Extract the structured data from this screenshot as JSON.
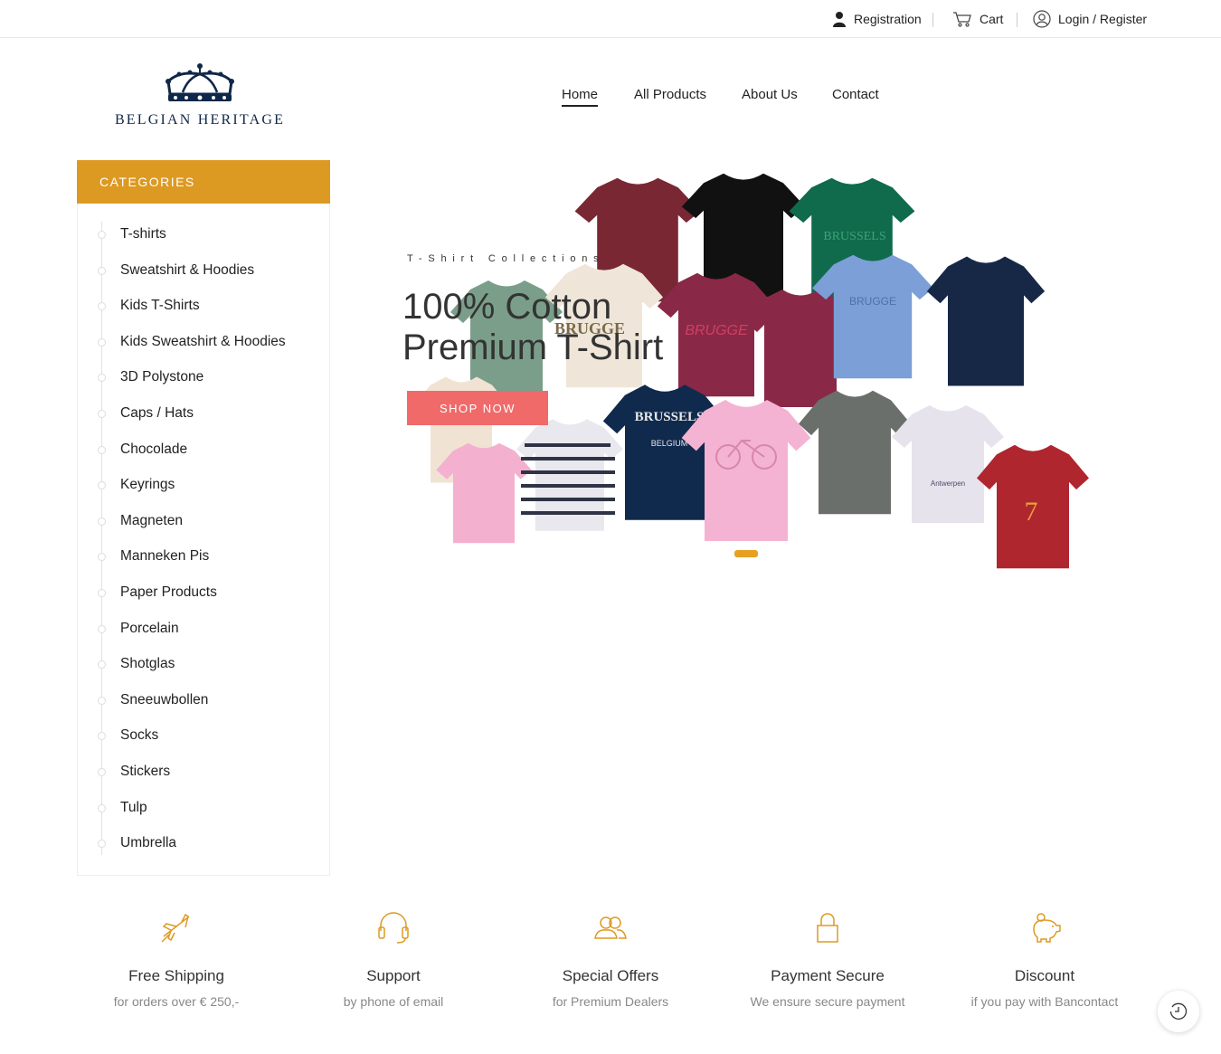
{
  "topbar": {
    "registration": "Registration",
    "cart": "Cart",
    "login": "Login / Register"
  },
  "logo": {
    "text": "BELGIAN HERITAGE"
  },
  "nav": {
    "items": [
      "Home",
      "All Products",
      "About Us",
      "Contact"
    ],
    "active": "Home"
  },
  "sidebar": {
    "title": "CATEGORIES",
    "items": [
      "T-shirts",
      "Sweatshirt & Hoodies",
      "Kids T-Shirts",
      "Kids Sweatshirt & Hoodies",
      "3D Polystone",
      "Caps / Hats",
      "Chocolade",
      "Keyrings",
      "Magneten",
      "Manneken Pis",
      "Paper Products",
      "Porcelain",
      "Shotglas",
      "Sneeuwbollen",
      "Socks",
      "Stickers",
      "Tulp",
      "Umbrella"
    ]
  },
  "hero": {
    "tag": "T-Shirt Collections",
    "title_line1": "100% Cotton",
    "title_line2": "Premium T-Shirt",
    "button": "SHOP NOW",
    "shirt_prints": [
      "BRUGGE",
      "BRUSSELS",
      "BELGIUM",
      "BRUGGE",
      "BRUSSELS",
      "7",
      "Antwerpen"
    ]
  },
  "features": [
    {
      "icon": "airplane-icon",
      "title": "Free Shipping",
      "subtitle": "for orders over € 250,-"
    },
    {
      "icon": "headset-icon",
      "title": "Support",
      "subtitle": "by phone of email"
    },
    {
      "icon": "users-icon",
      "title": "Special Offers",
      "subtitle": "for Premium Dealers"
    },
    {
      "icon": "lock-icon",
      "title": "Payment Secure",
      "subtitle": "We ensure secure payment"
    },
    {
      "icon": "piggy-bank-icon",
      "title": "Discount",
      "subtitle": "if you pay with Bancontact"
    }
  ],
  "colors": {
    "accent": "#dd9a23",
    "button": "#f06a6a",
    "logo": "#0f2748"
  }
}
